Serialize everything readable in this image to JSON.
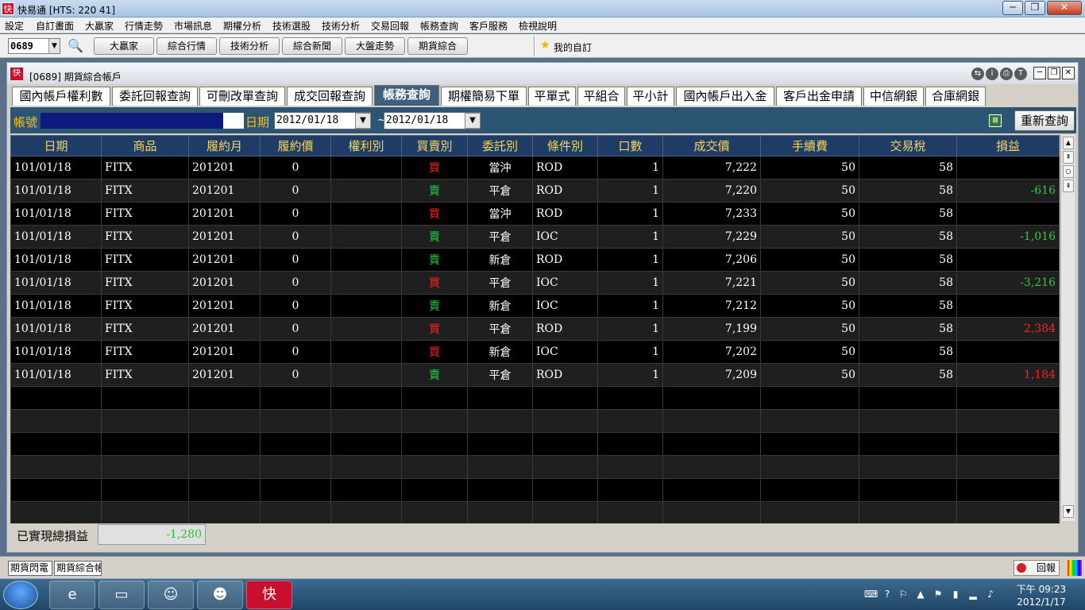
{
  "app": {
    "title": "快易通 [HTS: 220 41]",
    "icon": "快",
    "window_buttons": [
      "─",
      "❐",
      "✕"
    ]
  },
  "menu": [
    "設定",
    "自訂畫面",
    "大贏家",
    "行情走勢",
    "市場訊息",
    "期權分析",
    "技術選股",
    "技術分析",
    "交易回報",
    "帳務查詢",
    "客戶服務",
    "檢視說明"
  ],
  "toolbar": {
    "code": "0689",
    "buttons": [
      "大贏家",
      "綜合行情",
      "技術分析",
      "綜合新聞",
      "大盤走勢",
      "期貨綜合"
    ],
    "favorite": "我的自訂"
  },
  "window": {
    "title": "[0689] 期貨綜合帳戶",
    "icon": "快",
    "tool_icons": [
      "⇆",
      "i",
      "⎙",
      "T"
    ],
    "buttons": [
      "─",
      "❐",
      "✕"
    ]
  },
  "tabs": [
    "國內帳戶權利數",
    "委託回報查詢",
    "可刪改單查詢",
    "成交回報查詢",
    "帳務查詢",
    "期權簡易下單",
    "平單式",
    "平組合",
    "平小計",
    "國內帳戶出入金",
    "客戶出金申請",
    "中信網銀",
    "合庫網銀"
  ],
  "active_tab": "帳務查詢",
  "filter": {
    "account_label": "帳號",
    "date_label": "日期",
    "date_from": "2012/01/18",
    "date_to": "2012/01/18",
    "separator": "~",
    "requery": "重新查詢"
  },
  "table": {
    "headers": [
      "日期",
      "商品",
      "履約月",
      "履約價",
      "權利別",
      "買賣別",
      "委託別",
      "條件別",
      "口數",
      "成交價",
      "手續費",
      "交易稅",
      "損益"
    ],
    "rows": [
      {
        "date": "101/01/18",
        "product": "FITX",
        "month": "201201",
        "strike": "0",
        "right": "",
        "side": "買",
        "order": "當沖",
        "cond": "ROD",
        "qty": "1",
        "price": "7,222",
        "fee": "50",
        "tax": "58",
        "pnl": ""
      },
      {
        "date": "101/01/18",
        "product": "FITX",
        "month": "201201",
        "strike": "0",
        "right": "",
        "side": "賣",
        "order": "平倉",
        "cond": "ROD",
        "qty": "1",
        "price": "7,220",
        "fee": "50",
        "tax": "58",
        "pnl": "-616"
      },
      {
        "date": "101/01/18",
        "product": "FITX",
        "month": "201201",
        "strike": "0",
        "right": "",
        "side": "買",
        "order": "當沖",
        "cond": "ROD",
        "qty": "1",
        "price": "7,233",
        "fee": "50",
        "tax": "58",
        "pnl": ""
      },
      {
        "date": "101/01/18",
        "product": "FITX",
        "month": "201201",
        "strike": "0",
        "right": "",
        "side": "賣",
        "order": "平倉",
        "cond": "IOC",
        "qty": "1",
        "price": "7,229",
        "fee": "50",
        "tax": "58",
        "pnl": "-1,016"
      },
      {
        "date": "101/01/18",
        "product": "FITX",
        "month": "201201",
        "strike": "0",
        "right": "",
        "side": "賣",
        "order": "新倉",
        "cond": "ROD",
        "qty": "1",
        "price": "7,206",
        "fee": "50",
        "tax": "58",
        "pnl": ""
      },
      {
        "date": "101/01/18",
        "product": "FITX",
        "month": "201201",
        "strike": "0",
        "right": "",
        "side": "買",
        "order": "平倉",
        "cond": "IOC",
        "qty": "1",
        "price": "7,221",
        "fee": "50",
        "tax": "58",
        "pnl": "-3,216"
      },
      {
        "date": "101/01/18",
        "product": "FITX",
        "month": "201201",
        "strike": "0",
        "right": "",
        "side": "賣",
        "order": "新倉",
        "cond": "IOC",
        "qty": "1",
        "price": "7,212",
        "fee": "50",
        "tax": "58",
        "pnl": ""
      },
      {
        "date": "101/01/18",
        "product": "FITX",
        "month": "201201",
        "strike": "0",
        "right": "",
        "side": "買",
        "order": "平倉",
        "cond": "ROD",
        "qty": "1",
        "price": "7,199",
        "fee": "50",
        "tax": "58",
        "pnl": "2,384"
      },
      {
        "date": "101/01/18",
        "product": "FITX",
        "month": "201201",
        "strike": "0",
        "right": "",
        "side": "買",
        "order": "新倉",
        "cond": "IOC",
        "qty": "1",
        "price": "7,202",
        "fee": "50",
        "tax": "58",
        "pnl": ""
      },
      {
        "date": "101/01/18",
        "product": "FITX",
        "month": "201201",
        "strike": "0",
        "right": "",
        "side": "賣",
        "order": "平倉",
        "cond": "ROD",
        "qty": "1",
        "price": "7,209",
        "fee": "50",
        "tax": "58",
        "pnl": "1,184"
      }
    ],
    "empty_rows": 6
  },
  "summary": {
    "label": "已實現總損益",
    "value": "-1,280"
  },
  "status_tabs": [
    "期貨閃電",
    "期貨綜合帳戶"
  ],
  "report_button": "回報",
  "clock": {
    "time": "下午 09:23",
    "date": "2012/1/17"
  },
  "colors": {
    "buy": "#ff2020",
    "sell": "#20d040",
    "header_bg": "#1e3c66",
    "header_fg": "#f5d65b",
    "filter_bg": "#2c5573",
    "tab_active": "#3f5f7f"
  }
}
